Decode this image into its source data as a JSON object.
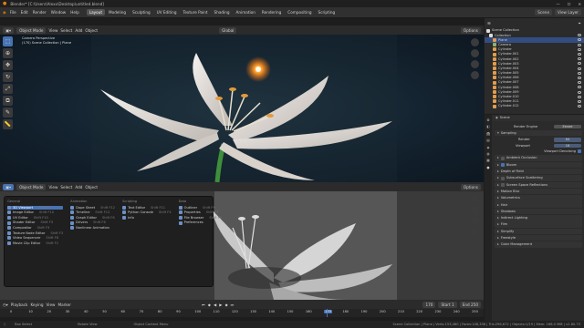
{
  "titlebar": {
    "text": "Blender* [C:\\Users\\Alexx\\Desktop\\untitled.blend]"
  },
  "menubar": {
    "menus": [
      "File",
      "Edit",
      "Render",
      "Window",
      "Help"
    ],
    "workspaces": [
      "Layout",
      "Modeling",
      "Sculpting",
      "UV Editing",
      "Texture Paint",
      "Shading",
      "Animation",
      "Rendering",
      "Compositing",
      "Scripting"
    ],
    "active_workspace": "Layout",
    "scene_label": "Scene",
    "view_layer_label": "View Layer"
  },
  "viewport_top": {
    "header": {
      "mode": "Object Mode",
      "menus": [
        "View",
        "Select",
        "Add",
        "Object"
      ],
      "orientation": "Global",
      "options": "Options"
    },
    "overlay_line1": "Camera Perspective",
    "overlay_line2": "(170) Scene Collection | Plane"
  },
  "viewport_bottom": {
    "header": {
      "mode": "Object Mode",
      "menus": [
        "View",
        "Select",
        "Add",
        "Object"
      ],
      "options": "Options"
    }
  },
  "editor_type_menu": {
    "columns": [
      {
        "heading": "General",
        "items": [
          {
            "label": "3D Viewport",
            "key": "Shift F5"
          },
          {
            "label": "Image Editor",
            "key": "Shift F10"
          },
          {
            "label": "UV Editor",
            "key": "Shift F10"
          },
          {
            "label": "Shader Editor",
            "key": "Shift F3"
          },
          {
            "label": "Compositor",
            "key": "Shift F3"
          },
          {
            "label": "Texture Node Editor",
            "key": "Shift F3"
          },
          {
            "label": "Video Sequencer",
            "key": "Shift F8"
          },
          {
            "label": "Movie Clip Editor",
            "key": "Shift F2"
          }
        ]
      },
      {
        "heading": "Animation",
        "items": [
          {
            "label": "Dope Sheet",
            "key": "Shift F12"
          },
          {
            "label": "Timeline",
            "key": "Shift F12"
          },
          {
            "label": "Graph Editor",
            "key": "Shift F6"
          },
          {
            "label": "Drivers",
            "key": "Shift F6"
          },
          {
            "label": "Nonlinear Animation",
            "key": ""
          }
        ]
      },
      {
        "heading": "Scripting",
        "items": [
          {
            "label": "Text Editor",
            "key": "Shift F11"
          },
          {
            "label": "Python Console",
            "key": "Shift F4"
          },
          {
            "label": "Info",
            "key": ""
          }
        ]
      },
      {
        "heading": "Data",
        "items": [
          {
            "label": "Outliner",
            "key": "Shift F9"
          },
          {
            "label": "Properties",
            "key": "Shift F7"
          },
          {
            "label": "File Browser",
            "key": "Shift F1"
          },
          {
            "label": "Preferences",
            "key": ""
          }
        ]
      }
    ],
    "selected": "3D Viewport"
  },
  "outliner": {
    "header": "Scene Collection",
    "rows": [
      "Collection",
      "Plane",
      "Camera",
      "Cylinder",
      "Cylinder.001",
      "Cylinder.002",
      "Cylinder.003",
      "Cylinder.004",
      "Cylinder.005",
      "Cylinder.006",
      "Cylinder.007",
      "Cylinder.008",
      "Cylinder.009",
      "Cylinder.010",
      "Cylinder.011",
      "Cylinder.012"
    ],
    "selected_row": "Plane"
  },
  "properties": {
    "scene_name": "Scene",
    "render_engine_label": "Render Engine",
    "render_engine_value": "Eevee",
    "sampling": "Sampling",
    "render_label": "Render",
    "render_value": "64",
    "viewport_label": "Viewport",
    "viewport_value": "16",
    "denoise_label": "Viewport Denoising",
    "sections": [
      "Ambient Occlusion",
      "Bloom",
      "Depth of Field",
      "Subsurface Scattering",
      "Screen Space Reflections",
      "Motion Blur",
      "Volumetrics",
      "Hair",
      "Shadows",
      "Indirect Lighting",
      "Film",
      "Simplify",
      "Freestyle",
      "Color Management"
    ]
  },
  "timeline": {
    "menus": [
      "Playback",
      "Keying",
      "View",
      "Marker"
    ],
    "current_frame": "170",
    "start_label": "Start",
    "start_value": "1",
    "end_label": "End",
    "end_value": "250",
    "ticks": [
      "0",
      "10",
      "20",
      "30",
      "40",
      "50",
      "60",
      "70",
      "80",
      "90",
      "100",
      "110",
      "120",
      "130",
      "140",
      "150",
      "160",
      "170",
      "180",
      "190",
      "200",
      "210",
      "220",
      "230",
      "240",
      "250"
    ]
  },
  "status": {
    "left": "Box Select",
    "mid1": "Rotate View",
    "mid2": "Object Context Menu",
    "right": "Scene Collection | Plane | Verts:153,460 | Faces:148,336 | Tris:296,672 | Objects:1/19 | Mem: 168.0 MiB | v2.80.75"
  },
  "colors": {
    "accent": "#4772b3",
    "selected_row": "#334d80",
    "panel": "#2b2b2b"
  }
}
